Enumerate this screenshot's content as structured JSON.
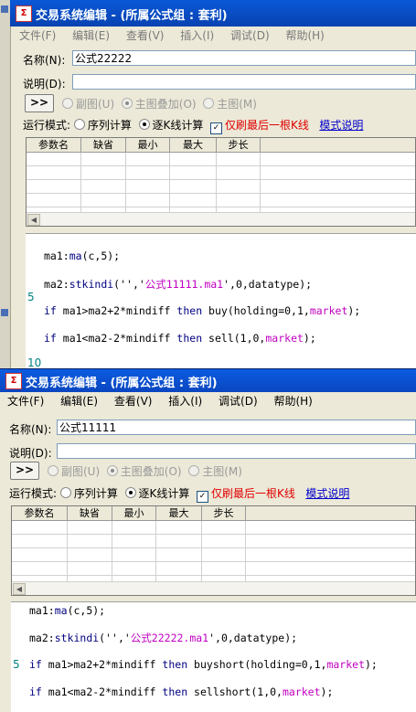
{
  "window1": {
    "title": "交易系统编辑 - (所属公式组 : 套利)",
    "menu": [
      "文件(F)",
      "编辑(E)",
      "查看(V)",
      "插入(I)",
      "调试(D)",
      "帮助(H)"
    ],
    "name_label": "名称(N):",
    "name_value": "公式22222",
    "desc_label": "说明(D):",
    "desc_value": "",
    "expand_button": ">>",
    "chart_options": [
      "副图(U)",
      "主图叠加(O)",
      "主图(M)"
    ],
    "run_mode_label": "运行模式:",
    "run_modes": [
      "序列计算",
      "逐K线计算"
    ],
    "refresh_last": "仅刷最后一根K线",
    "mode_help": "模式说明",
    "columns": [
      "参数名",
      "缺省",
      "最小",
      "最大",
      "步长"
    ],
    "line_numbers": [
      "5",
      "10"
    ],
    "code": [
      {
        "pre": "ma1:",
        "fn": "ma",
        "post": "(c,5);"
      },
      {
        "pre": "ma2:",
        "fn": "stkindi",
        "post": "('','",
        "str": "公式11111.ma1",
        "post2": "',0,datatype);"
      },
      {
        "kw1": "if",
        "mid": " ma1>ma2+2*mindiff ",
        "kw2": "then",
        "call": " buy(holding=0,1,",
        "arg": "market",
        "end": ");"
      },
      {
        "kw1": "if",
        "mid": " ma1<ma2-2*mindiff ",
        "kw2": "then",
        "call": " sell(1,0,",
        "arg": "market",
        "end": ");"
      }
    ]
  },
  "window2": {
    "title": "交易系统编辑 - (所属公式组 : 套利)",
    "menu": [
      "文件(F)",
      "编辑(E)",
      "查看(V)",
      "插入(I)",
      "调试(D)",
      "帮助(H)"
    ],
    "name_label": "名称(N):",
    "name_value": "公式11111",
    "desc_label": "说明(D):",
    "desc_value": "",
    "expand_button": ">>",
    "chart_options": [
      "副图(U)",
      "主图叠加(O)",
      "主图(M)"
    ],
    "run_mode_label": "运行模式:",
    "run_modes": [
      "序列计算",
      "逐K线计算"
    ],
    "refresh_last": "仅刷最后一根K线",
    "mode_help": "模式说明",
    "columns": [
      "参数名",
      "缺省",
      "最小",
      "最大",
      "步长"
    ],
    "line_numbers": [
      "5"
    ],
    "code": [
      {
        "pre": "ma1:",
        "fn": "ma",
        "post": "(c,5);"
      },
      {
        "pre": "ma2:",
        "fn": "stkindi",
        "post": "('','",
        "str": "公式22222.ma1",
        "post2": "',0,datatype);"
      },
      {
        "kw1": "if",
        "mid": " ma1>ma2+2*mindiff ",
        "kw2": "then",
        "call": " buyshort(holding=0,1,",
        "arg": "market",
        "end": ");"
      },
      {
        "kw1": "if",
        "mid": " ma1<ma2-2*mindiff ",
        "kw2": "then",
        "call": " sellshort(1,0,",
        "arg": "market",
        "end": ");"
      }
    ]
  }
}
